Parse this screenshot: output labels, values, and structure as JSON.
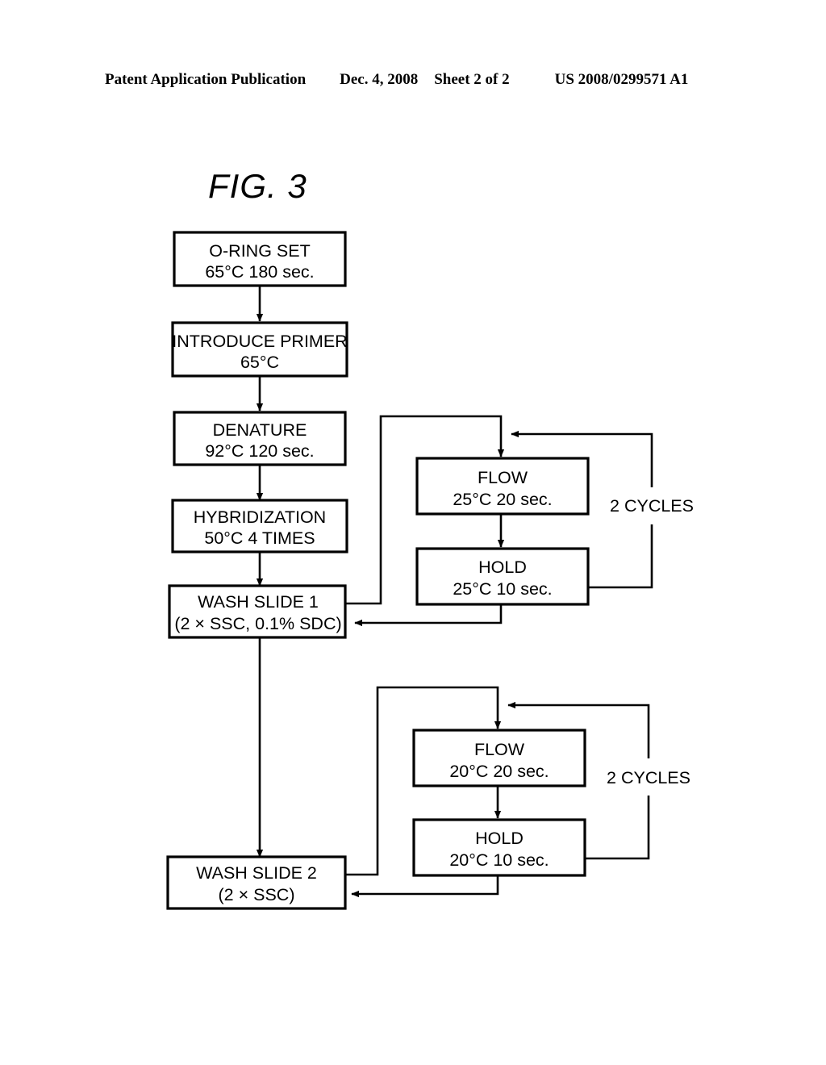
{
  "header": {
    "publication": "Patent Application Publication",
    "date": "Dec. 4, 2008",
    "sheet": "Sheet 2 of 2",
    "patent_number": "US 2008/0299571 A1"
  },
  "figure": {
    "label": "FIG.  3",
    "type": "process-flowchart",
    "line_color": "#000000",
    "background_color": "#ffffff"
  },
  "flowchart": {
    "nodes": [
      {
        "id": "o-ring-set",
        "line1": "O-RING SET",
        "line2": "65°C  180 sec.",
        "column": "left"
      },
      {
        "id": "introduce-primer",
        "line1": "INTRODUCE PRIMER",
        "line2": "65°C",
        "column": "left"
      },
      {
        "id": "denature",
        "line1": "DENATURE",
        "line2": "92°C  120 sec.",
        "column": "left"
      },
      {
        "id": "hybridization",
        "line1": "HYBRIDIZATION",
        "line2": "50°C   4 TIMES",
        "column": "left"
      },
      {
        "id": "wash-slide-1",
        "line1": "WASH SLIDE 1",
        "line2": "(2 × SSC,  0.1% SDC)",
        "column": "left"
      },
      {
        "id": "wash-slide-2",
        "line1": "WASH SLIDE 2",
        "line2": "(2 × SSC)",
        "column": "left"
      },
      {
        "id": "flow-upper",
        "line1": "FLOW",
        "line2": "25°C  20 sec.",
        "column": "right"
      },
      {
        "id": "hold-upper",
        "line1": "HOLD",
        "line2": "25°C  10 sec.",
        "column": "right"
      },
      {
        "id": "flow-lower",
        "line1": "FLOW",
        "line2": "20°C  20 sec.",
        "column": "right"
      },
      {
        "id": "hold-lower",
        "line1": "HOLD",
        "line2": "20°C  10 sec.",
        "column": "right"
      }
    ],
    "annotations": [
      {
        "id": "cycles-upper",
        "text": "2 CYCLES"
      },
      {
        "id": "cycles-lower",
        "text": "2 CYCLES"
      }
    ],
    "edges": [
      {
        "from": "o-ring-set",
        "to": "introduce-primer",
        "style": "arrow-down"
      },
      {
        "from": "introduce-primer",
        "to": "denature",
        "style": "arrow-down"
      },
      {
        "from": "denature",
        "to": "hybridization",
        "style": "arrow-down"
      },
      {
        "from": "hybridization",
        "to": "wash-slide-1",
        "style": "arrow-down"
      },
      {
        "from": "wash-slide-1",
        "to": "wash-slide-2",
        "style": "arrow-down-long"
      },
      {
        "from": "wash-slide-1",
        "to": "flow-upper",
        "style": "route-right-up-over-down-arrow"
      },
      {
        "from": "flow-upper",
        "to": "hold-upper",
        "style": "arrow-down"
      },
      {
        "from": "hold-upper",
        "to": "flow-upper",
        "style": "loop-right-up-arrow-left",
        "label": "2 CYCLES"
      },
      {
        "from": "hold-upper",
        "to": "wash-slide-1",
        "style": "route-down-left-arrow"
      },
      {
        "from": "wash-slide-2",
        "to": "flow-lower",
        "style": "route-right-up-over-down-arrow"
      },
      {
        "from": "flow-lower",
        "to": "hold-lower",
        "style": "arrow-down"
      },
      {
        "from": "hold-lower",
        "to": "flow-lower",
        "style": "loop-right-up-arrow-left",
        "label": "2 CYCLES"
      },
      {
        "from": "hold-lower",
        "to": "wash-slide-2",
        "style": "route-down-left-arrow"
      }
    ]
  }
}
